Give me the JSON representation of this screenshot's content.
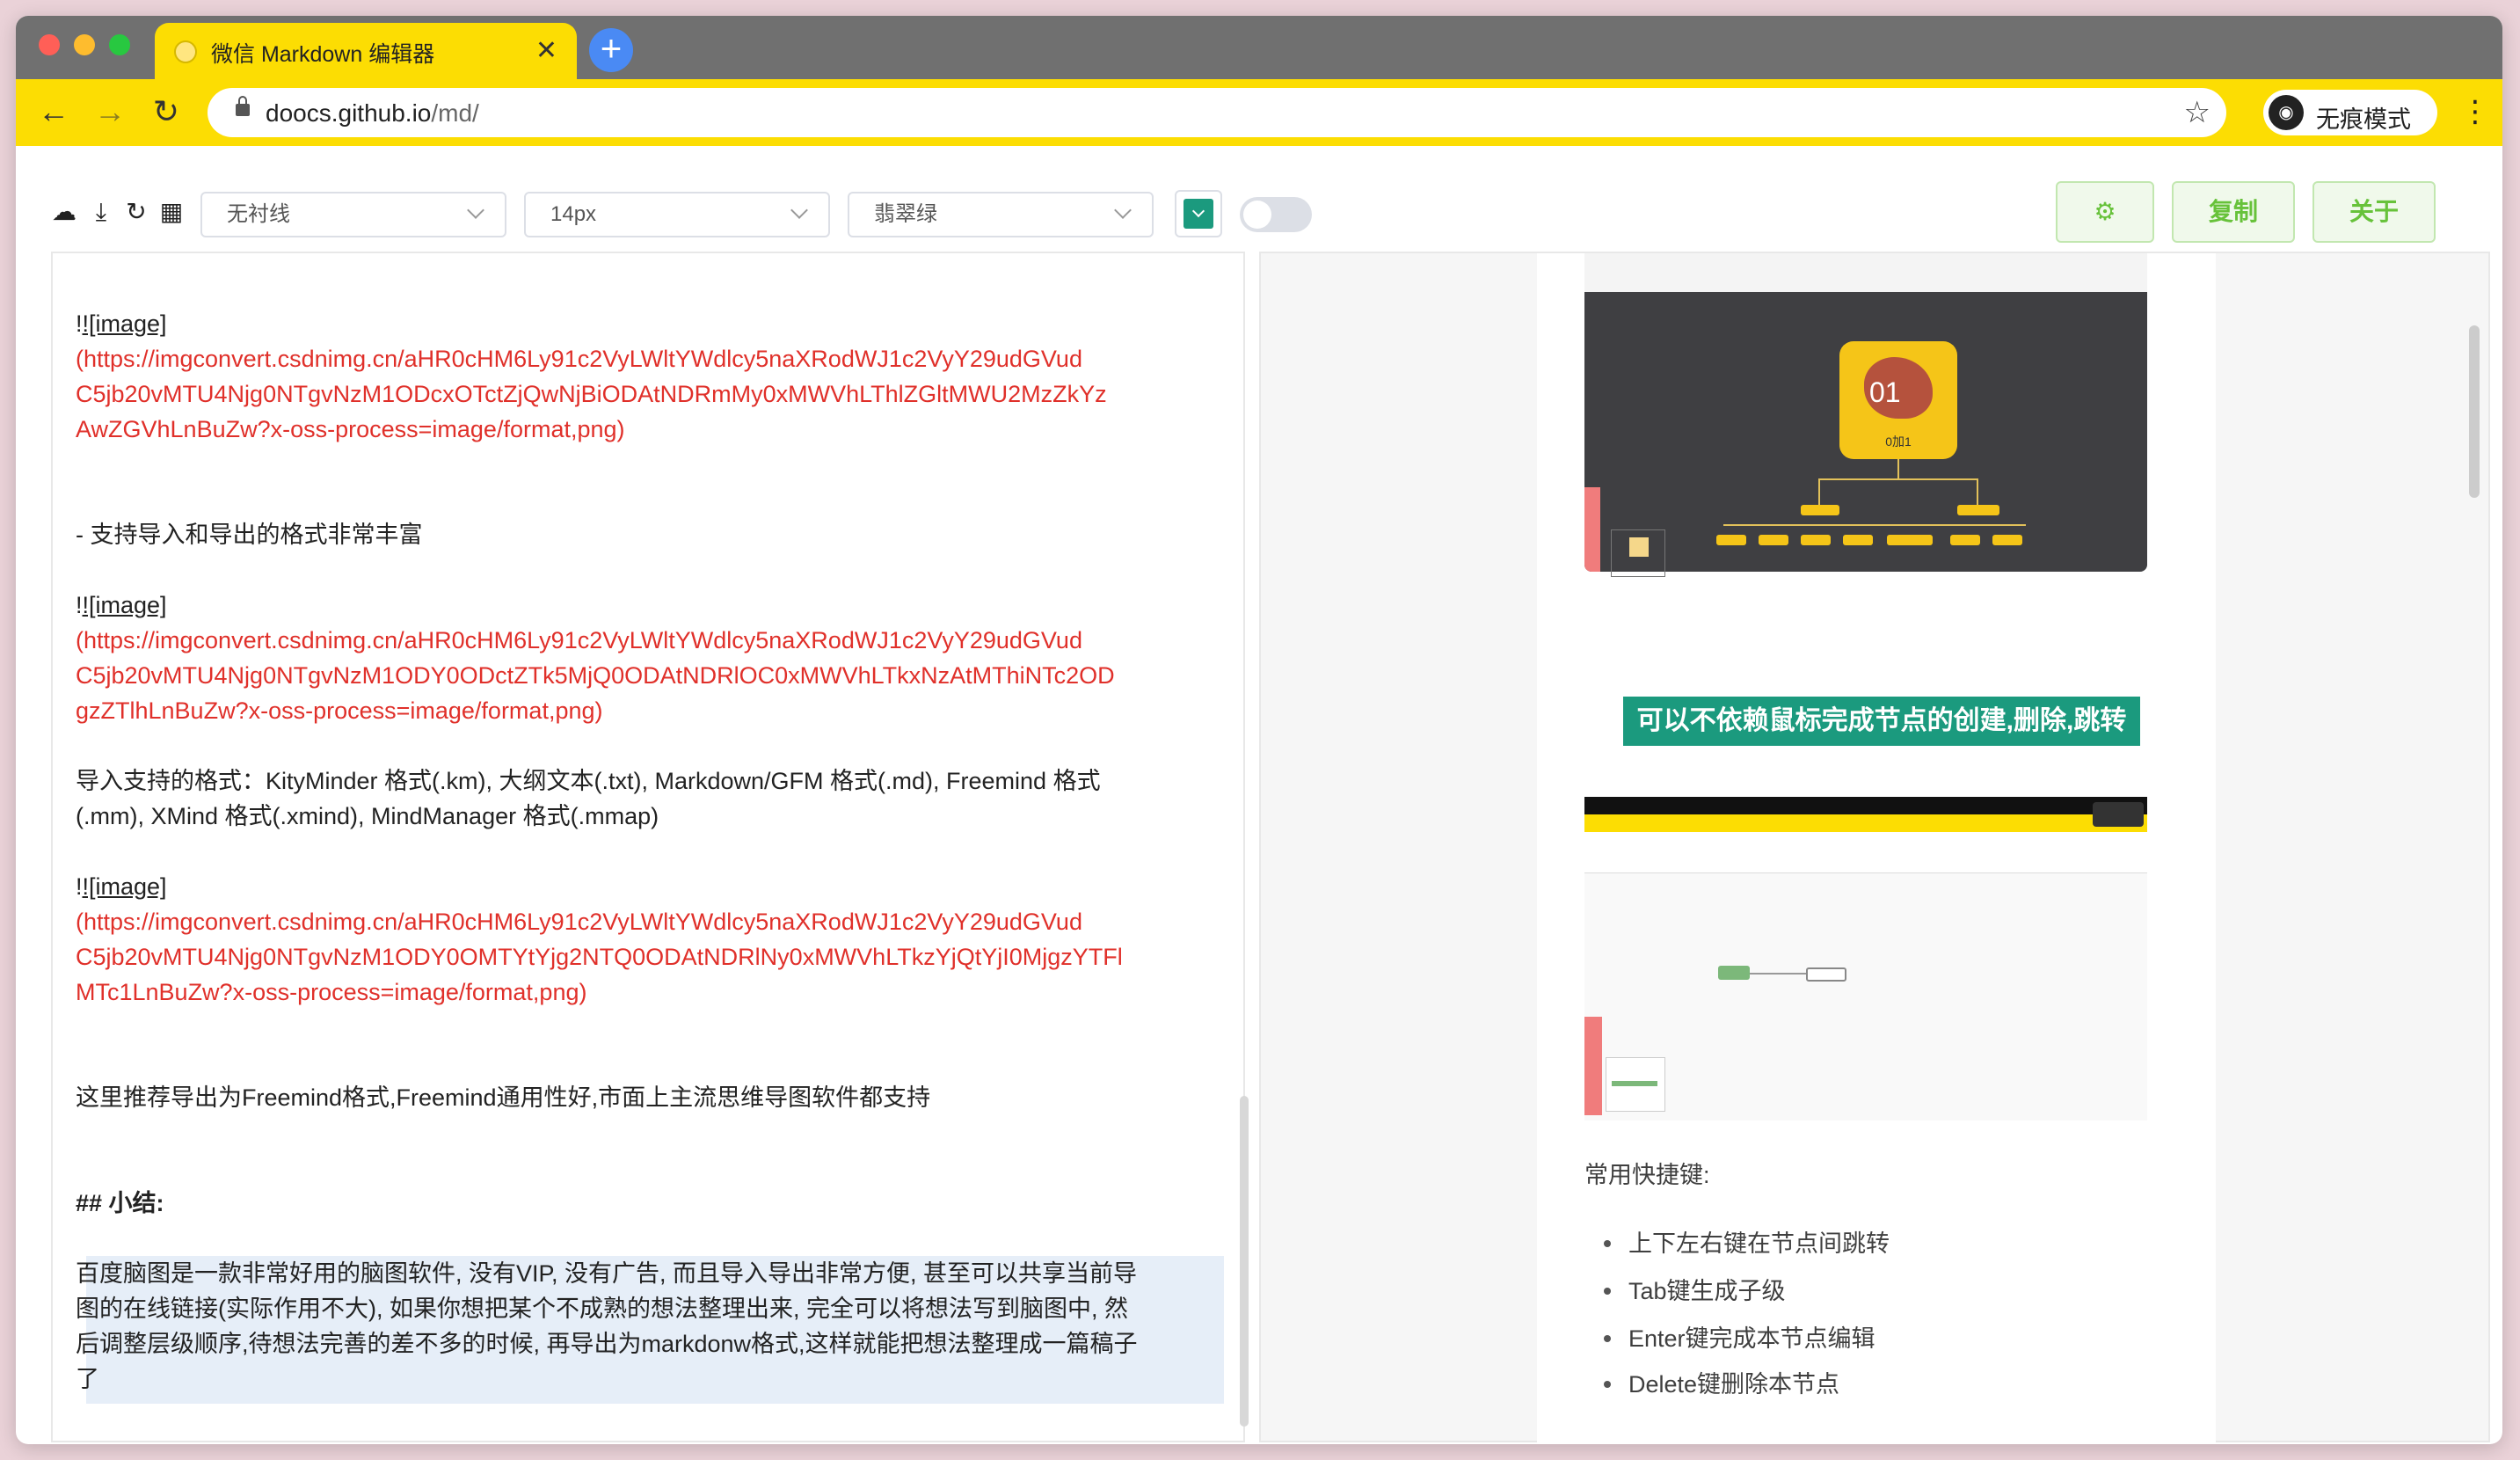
{
  "browser": {
    "tab_title": "微信 Markdown 编辑器",
    "tab_close": "✕",
    "new_tab": "+",
    "nav_back": "←",
    "nav_forward": "→",
    "nav_reload": "↻",
    "url_domain": "doocs.github.io",
    "url_path": "/md/",
    "bookmark_star": "☆",
    "incognito_label": "无痕模式",
    "menu": "⋮"
  },
  "editor_toolbar": {
    "font_family": "无衬线",
    "font_size": "14px",
    "theme_color": "翡翠绿",
    "theme_color_hex": "#1b9a7e",
    "settings_label": "⚙",
    "copy_label": "复制",
    "about_label": "关于"
  },
  "markdown": {
    "img1_alt": "![image]",
    "img1_url": [
      "(https://imgconvert.csdnimg.cn/aHR0cHM6Ly91c2VyLWltYWdlcy5naXRodWJ1c2VyY29udGVud",
      "C5jb20vMTU4Njg0NTgvNzM1ODcxOTctZjQwNjBiODAtNDRmMy0xMWVhLThlZGltMWU2MzZkYz",
      "AwZGVhLnBuZw?x-oss-process=image/format,png)"
    ],
    "list_item": "- 支持导入和导出的格式非常丰富",
    "img2_alt": "![image]",
    "img2_url": [
      "(https://imgconvert.csdnimg.cn/aHR0cHM6Ly91c2VyLWltYWdlcy5naXRodWJ1c2VyY29udGVud",
      "C5jb20vMTU4Njg0NTgvNzM1ODY0ODctZTk5MjQ0ODAtNDRlOC0xMWVhLTkxNzAtMThiNTc2OD",
      "gzZTlhLnBuZw?x-oss-process=image/format,png)"
    ],
    "formats_line1": "导入支持的格式：KityMinder 格式(.km), 大纲文本(.txt), Markdown/GFM 格式(.md), Freemind 格式",
    "formats_line2": "(.mm), XMind 格式(.xmind), MindManager 格式(.mmap)",
    "img3_alt": "![image]",
    "img3_url": [
      "(https://imgconvert.csdnimg.cn/aHR0cHM6Ly91c2VyLWltYWdlcy5naXRodWJ1c2VyY29udGVud",
      "C5jb20vMTU4Njg0NTgvNzM1ODY0OMTYtYjg2NTQ0ODAtNDRlNy0xMWVhLTkzYjQtYjI0MjgzYTFl",
      "MTc1LnBuZw?x-oss-process=image/format,png)"
    ],
    "recommend": "这里推荐导出为Freemind格式,Freemind通用性好,市面上主流思维导图软件都支持",
    "heading": "## 小结:",
    "summary": [
      "百度脑图是一款非常好用的脑图软件, 没有VIP, 没有广告, 而且导入导出非常方便, 甚至可以共享当前导",
      "图的在线链接(实际作用不大), 如果你想把某个不成熟的想法整理出来, 完全可以将想法写到脑图中, 然",
      "后调整层级顺序,待想法完善的差不多的时候, 再导出为markdonw格式,这样就能把想法整理成一篇稿子",
      "了"
    ]
  },
  "preview": {
    "mindmap1_center_number": "01",
    "mindmap1_center_caption": "0加1",
    "highlight_caption": "可以不依赖鼠标完成节点的创建,删除,跳转",
    "shortcuts_title": "常用快捷键:",
    "shortcuts": [
      "上下左右键在节点间跳转",
      "Tab键生成子级",
      "Enter键完成本节点编辑",
      "Delete键删除本节点"
    ]
  }
}
